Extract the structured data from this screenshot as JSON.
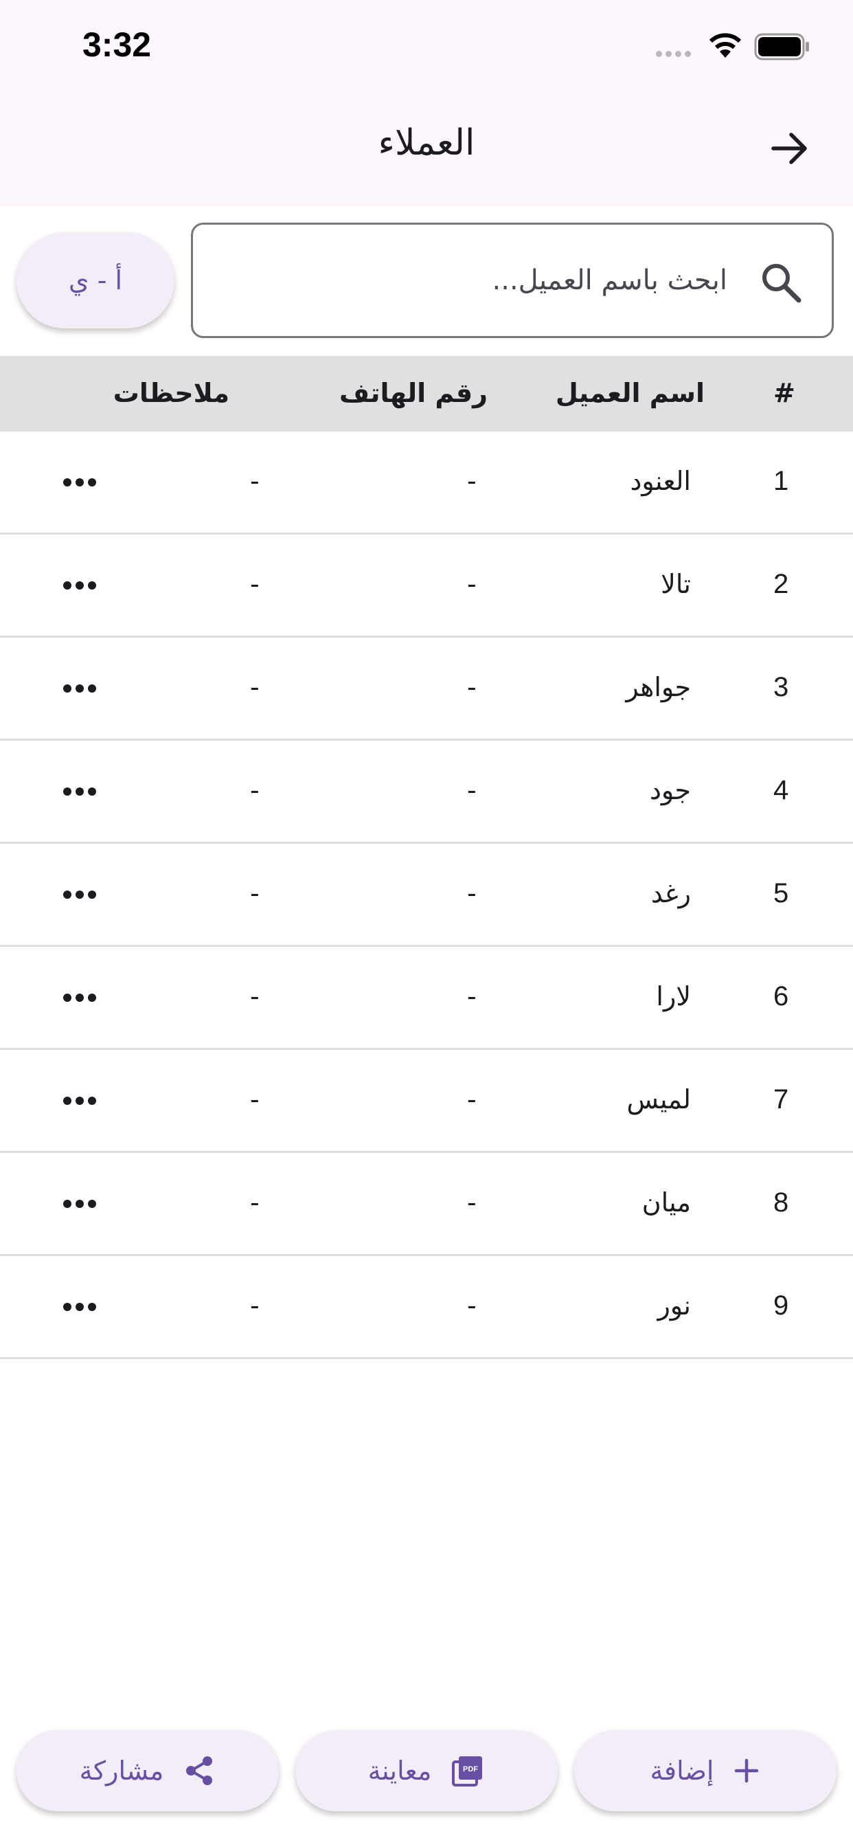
{
  "status_bar": {
    "time": "3:32"
  },
  "header": {
    "title": "العملاء"
  },
  "search": {
    "placeholder": "ابحث باسم العميل..."
  },
  "sort_button": {
    "label": "أ - ي"
  },
  "table": {
    "headers": {
      "index": "#",
      "name": "اسم العميل",
      "phone": "رقم الهاتف",
      "notes": "ملاحظات"
    },
    "rows": [
      {
        "index": "1",
        "name": "العنود",
        "phone": "-",
        "notes": "-"
      },
      {
        "index": "2",
        "name": "تالا",
        "phone": "-",
        "notes": "-"
      },
      {
        "index": "3",
        "name": "جواهر",
        "phone": "-",
        "notes": "-"
      },
      {
        "index": "4",
        "name": "جود",
        "phone": "-",
        "notes": "-"
      },
      {
        "index": "5",
        "name": "رغد",
        "phone": "-",
        "notes": "-"
      },
      {
        "index": "6",
        "name": "لارا",
        "phone": "-",
        "notes": "-"
      },
      {
        "index": "7",
        "name": "لميس",
        "phone": "-",
        "notes": "-"
      },
      {
        "index": "8",
        "name": "ميان",
        "phone": "-",
        "notes": "-"
      },
      {
        "index": "9",
        "name": "نور",
        "phone": "-",
        "notes": "-"
      }
    ]
  },
  "actions": {
    "add": "إضافة",
    "preview": "معاينة",
    "share": "مشاركة",
    "pdf_icon_text": "PDF"
  },
  "colors": {
    "accent": "#6750a4",
    "header_bg": "#fdf7fd",
    "table_header_bg": "#e0e0e0",
    "button_bg": "#f3edf7"
  }
}
